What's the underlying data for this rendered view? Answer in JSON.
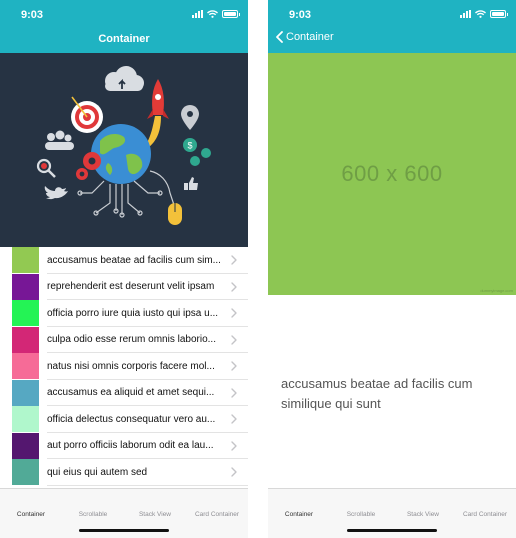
{
  "status_bar": {
    "time": "9:03"
  },
  "left_screen": {
    "title": "Container",
    "items": [
      {
        "label": "accusamus beatae ad facilis cum sim...",
        "color": "#92c952"
      },
      {
        "label": "reprehenderit est deserunt velit ipsam",
        "color": "#771796"
      },
      {
        "label": "officia porro iure quia iusto qui ipsa u...",
        "color": "#24f355"
      },
      {
        "label": "culpa odio esse rerum omnis laborio...",
        "color": "#d32776"
      },
      {
        "label": "natus nisi omnis corporis facere mol...",
        "color": "#f66b97"
      },
      {
        "label": "accusamus ea aliquid et amet sequi...",
        "color": "#56a8c2"
      },
      {
        "label": "officia delectus consequatur vero au...",
        "color": "#b0f7cc"
      },
      {
        "label": "aut porro officiis laborum odit ea lau...",
        "color": "#54176f"
      },
      {
        "label": "qui eius qui autem sed",
        "color": "#51aa97"
      }
    ]
  },
  "right_screen": {
    "back_label": "Container",
    "image_text": "600 x 600",
    "image_footer": "dummyimage.com",
    "description": "accusamus beatae ad facilis cum similique qui sunt"
  },
  "tabs": [
    "Container",
    "Scrollable",
    "Stack View",
    "Card Container"
  ],
  "active_tab": "Container",
  "colors": {
    "accent": "#1fb3c2",
    "placeholder": "#8dc653"
  }
}
